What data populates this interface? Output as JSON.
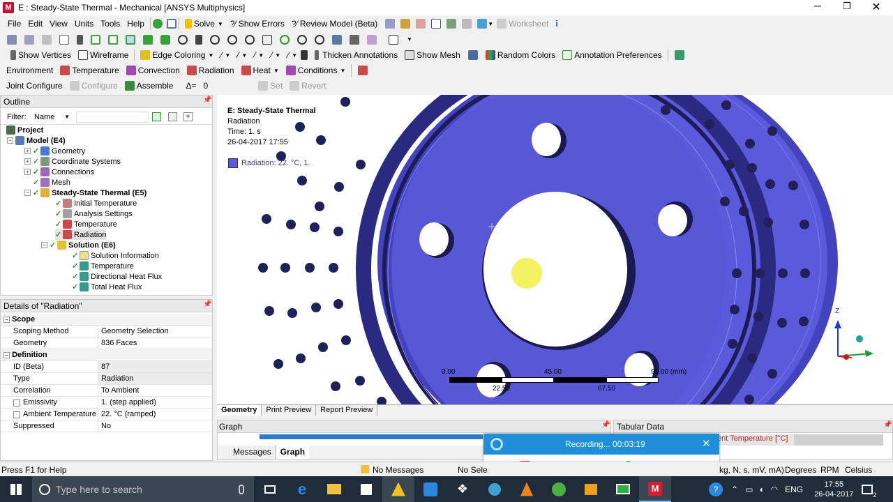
{
  "title_bar": {
    "title": "E : Steady-State Thermal - Mechanical [ANSYS Multiphysics]"
  },
  "menu": [
    "File",
    "Edit",
    "View",
    "Units",
    "Tools",
    "Help"
  ],
  "toolbar1": {
    "solve": "Solve",
    "show_errors": "?⁄ Show Errors",
    "review_model": "?⁄ Review Model (Beta)",
    "worksheet": "Worksheet"
  },
  "toolbar3": {
    "show_vertices": "Show Vertices",
    "wireframe": "Wireframe",
    "edge_coloring": "Edge Coloring",
    "thicken": "Thicken Annotations",
    "show_mesh": "Show Mesh",
    "random_colors": "Random Colors",
    "annotation_prefs": "Annotation Preferences"
  },
  "context_toolbar": {
    "environment": "Environment",
    "temperature": "Temperature",
    "convection": "Convection",
    "radiation": "Radiation",
    "heat": "Heat",
    "conditions": "Conditions"
  },
  "joint_toolbar": {
    "joint_configure": "Joint Configure",
    "configure": "Configure",
    "assemble": "Assemble",
    "delta": "Δ=",
    "delta_value": "0",
    "set": "Set",
    "revert": "Revert"
  },
  "outline": {
    "header": "Outline",
    "filter_label": "Filter:",
    "filter_value": "Name",
    "tree": [
      "Project",
      "Model (E4)",
      "Geometry",
      "Coordinate Systems",
      "Connections",
      "Mesh",
      "Steady-State Thermal (E5)",
      "Initial Temperature",
      "Analysis Settings",
      "Temperature",
      "Radiation",
      "Solution (E6)",
      "Solution Information",
      "Temperature",
      "Directional Heat Flux",
      "Total Heat Flux"
    ]
  },
  "details": {
    "header": "Details of \"Radiation\"",
    "scope": "Scope",
    "scoping_method_k": "Scoping Method",
    "scoping_method_v": "Geometry Selection",
    "geometry_k": "Geometry",
    "geometry_v": "836 Faces",
    "definition": "Definition",
    "id_k": "ID (Beta)",
    "id_v": "87",
    "type_k": "Type",
    "type_v": "Radiation",
    "correlation_k": "Correlation",
    "correlation_v": "To Ambient",
    "emissivity_k": "Emissivity",
    "emissivity_v": "1.   (step applied)",
    "ambient_k": "Ambient Temperature",
    "ambient_v": "22. °C  (ramped)",
    "suppressed_k": "Suppressed",
    "suppressed_v": "No"
  },
  "viewport": {
    "title": "E: Steady-State Thermal",
    "subtitle": "Radiation",
    "time": "Time: 1. s",
    "date": "26-04-2017 17:55",
    "legend": "Radiation: 22. °C, 1.",
    "scale": [
      "0.00",
      "45.00",
      "90.00 (mm)",
      "22.50",
      "67.50"
    ],
    "axis_z": "Z",
    "tabs": [
      "Geometry",
      "Print Preview",
      "Report Preview"
    ]
  },
  "graph_panel": {
    "header": "Graph",
    "tabs": [
      "Messages",
      "Graph"
    ]
  },
  "tabular_panel": {
    "header": "Tabular Data",
    "column": "ent Temperature [°C]"
  },
  "recorder": {
    "status": "Recording... 00:03:19"
  },
  "status_bar": {
    "help": "Press F1 for Help",
    "messages": "No Messages",
    "selection": "No Sele",
    "units": "kg, N, s, mV, mA)",
    "angle": "Degrees",
    "rpm": "RPM",
    "temp": "Celsius"
  },
  "taskbar": {
    "search_placeholder": "Type here to search",
    "lang": "ENG",
    "time": "17:55",
    "date": "26-04-2017",
    "notifications": "2"
  },
  "colors": {
    "model_blue": "#5a5adb",
    "accent": "#0078d7",
    "record_red": "#e04040"
  }
}
